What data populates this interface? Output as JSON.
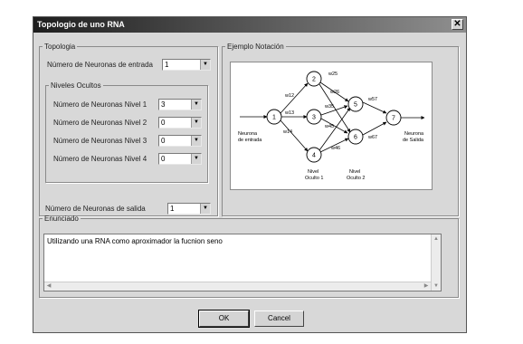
{
  "window": {
    "title": "Topologio de uno RNA",
    "close_glyph": "✕"
  },
  "topologia": {
    "legend": "Topologia",
    "entrada_label": "Número de Neuronas de entrada",
    "entrada_value": "1",
    "niveles": {
      "legend": "Niveles Ocultos",
      "rows": [
        {
          "label": "Número de Neuronas Nivel 1",
          "value": "3"
        },
        {
          "label": "Número de Neuronas Nivel 2",
          "value": "0"
        },
        {
          "label": "Número de Neuronas Nivel 3",
          "value": "0"
        },
        {
          "label": "Número de Neuronas Nivel 4",
          "value": "0"
        }
      ]
    },
    "salida_label": "Número de Neuronas de salida",
    "salida_value": "1"
  },
  "ejemplo": {
    "legend": "Ejemplo Notación",
    "nodes": [
      "1",
      "2",
      "3",
      "4",
      "5",
      "6",
      "7"
    ],
    "weights": [
      "w12",
      "w13",
      "w14",
      "w25",
      "w26",
      "w35",
      "w45",
      "w46",
      "w57",
      "w67"
    ],
    "label_entrada": [
      "Neurona",
      "de entrada"
    ],
    "label_nivel1": [
      "Nivel",
      "Oculto 1"
    ],
    "label_nivel2": [
      "Nivel",
      "Oculto 2"
    ],
    "label_salida": [
      "Neurona",
      "de Salida"
    ]
  },
  "enunciado": {
    "legend": "Enunciado",
    "text": "Utilizando una RNA como aproximador la fucnion seno"
  },
  "buttons": {
    "ok": "OK",
    "cancel": "Cancel"
  },
  "icons": {
    "dropdown": "dropdown-arrow-icon",
    "close": "close-icon"
  },
  "colors": {
    "titlebar_start": "#1e1e1e",
    "dialog_bg": "#d8d8d8"
  }
}
